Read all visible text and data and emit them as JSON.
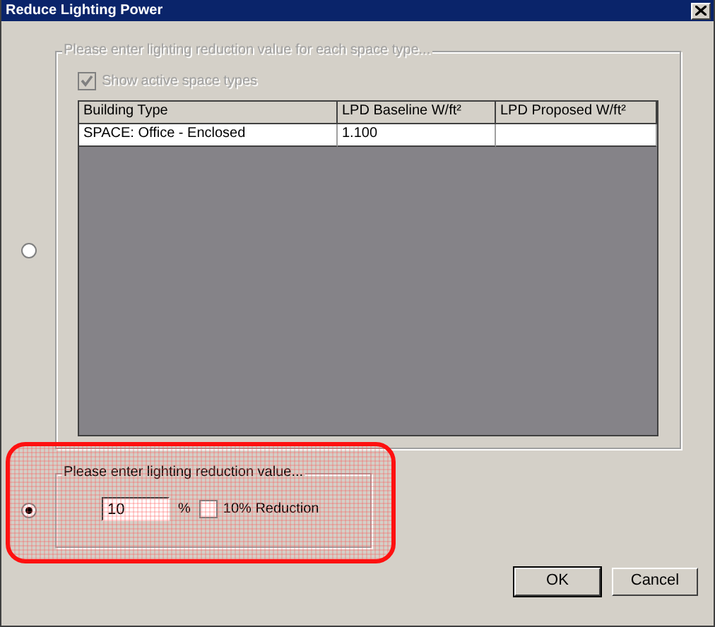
{
  "window": {
    "title": "Reduce Lighting Power"
  },
  "options": [
    {
      "kind": "per_space",
      "selected": false,
      "disabled": true,
      "group_title": "Please enter lighting reduction value for each space type...",
      "show_active": {
        "label": "Show active space types",
        "checked": true
      },
      "table": {
        "columns": [
          "Building Type",
          "LPD Baseline W/ft²",
          "LPD Proposed W/ft²"
        ],
        "rows": [
          [
            "SPACE: Office - Enclosed",
            "1.100",
            ""
          ]
        ]
      }
    },
    {
      "kind": "overall",
      "selected": true,
      "disabled": false,
      "group_title": "Please enter lighting reduction value...",
      "value": "10",
      "unit": "%",
      "reduction": {
        "label": "10% Reduction",
        "checked": false
      }
    }
  ],
  "buttons": [
    {
      "label": "OK",
      "default": true
    },
    {
      "label": "Cancel",
      "default": false
    }
  ]
}
